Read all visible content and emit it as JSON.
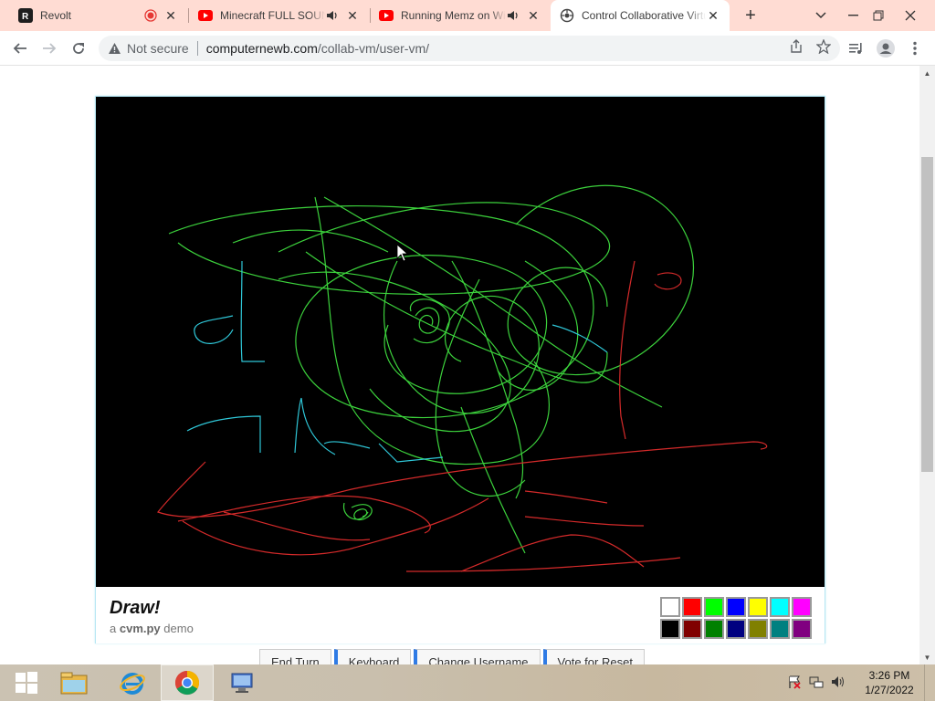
{
  "browser": {
    "tabs": [
      {
        "title": "Revolt",
        "favicon": "revolt-icon",
        "recording": true,
        "audio": false,
        "active": false
      },
      {
        "title": "Minecraft FULL SOUNDTRACK",
        "favicon": "youtube-icon",
        "recording": false,
        "audio": true,
        "active": false
      },
      {
        "title": "Running Memz on Windows",
        "favicon": "youtube-icon",
        "recording": false,
        "audio": true,
        "active": false
      },
      {
        "title": "Control Collaborative Virtual Machines",
        "favicon": "collabvm-icon",
        "recording": false,
        "audio": false,
        "active": true
      }
    ],
    "new_tab_label": "+",
    "omnibox": {
      "security_label": "Not secure",
      "url_domain": "computernewb.com",
      "url_path": "/collab-vm/user-vm/"
    }
  },
  "page": {
    "footer": {
      "title": "Draw!",
      "subtitle_prefix": "a",
      "subtitle_app": "cvm.py",
      "subtitle_suffix": "demo"
    },
    "palette": {
      "light": [
        "#ffffff",
        "#ff0000",
        "#00ff00",
        "#0000ff",
        "#ffff00",
        "#00ffff",
        "#ff00ff"
      ],
      "dark": [
        "#000000",
        "#800000",
        "#008000",
        "#000080",
        "#808000",
        "#008080",
        "#800080"
      ]
    },
    "buttons": [
      "End Turn",
      "Keyboard",
      "Change Username",
      "Vote for Reset"
    ]
  },
  "taskbar": {
    "apps": [
      "file-explorer-icon",
      "internet-explorer-icon",
      "chrome-icon",
      "remote-desktop-icon"
    ],
    "time": "3:26 PM",
    "date": "1/27/2022"
  }
}
